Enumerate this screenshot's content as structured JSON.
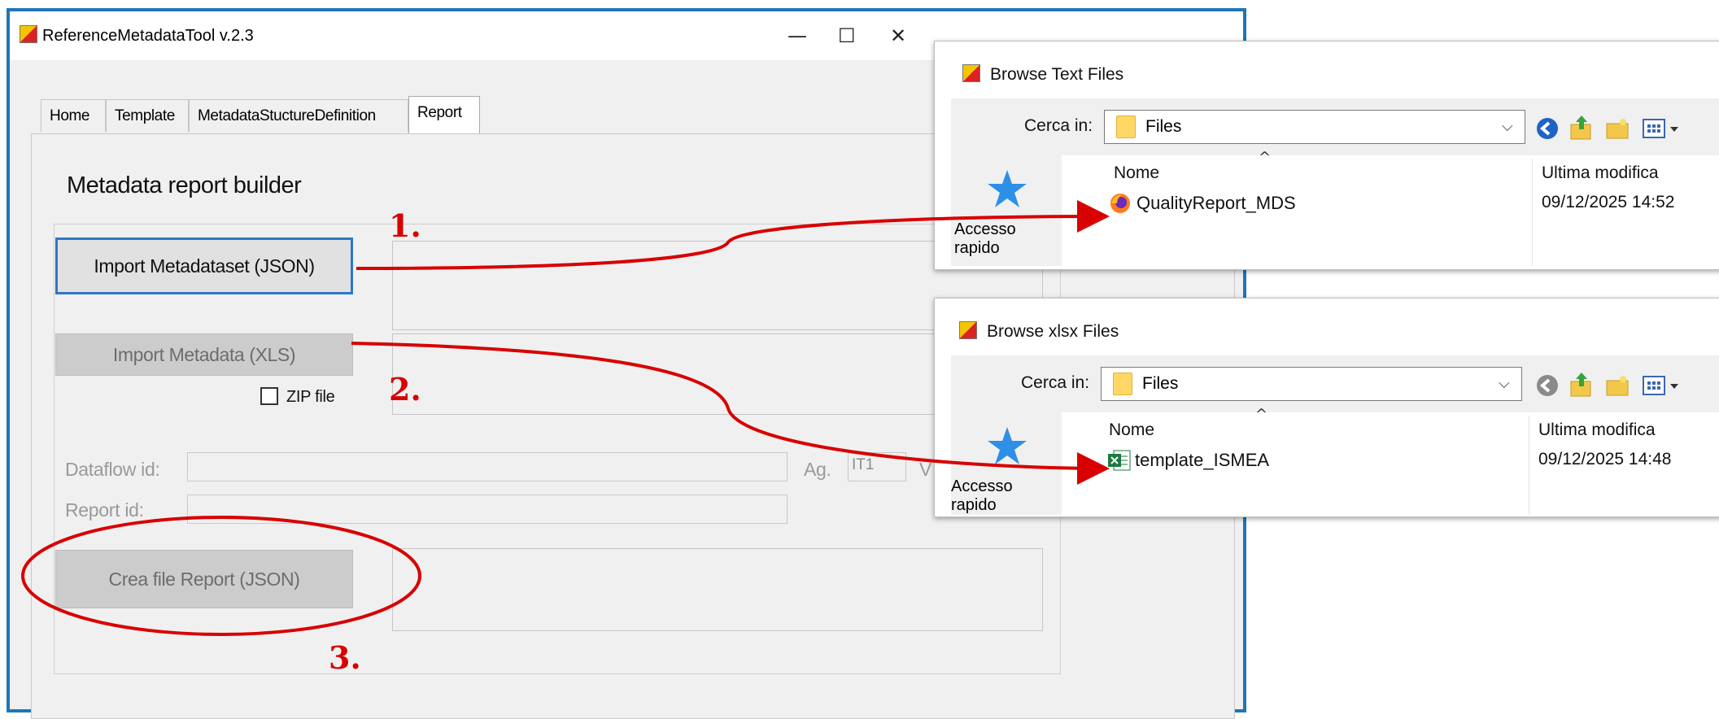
{
  "main_window": {
    "title": "ReferenceMetadataTool v.2.3",
    "controls": {
      "minimize": "—",
      "maximize": "☐",
      "close": "✕"
    },
    "tabs": [
      {
        "label": "Home"
      },
      {
        "label": "Template"
      },
      {
        "label": "MetadataStuctureDefinition"
      },
      {
        "label": "Report"
      }
    ],
    "report": {
      "heading": "Metadata report builder",
      "import_json_label": "Import Metadataset (JSON)",
      "import_xls_label": "Import Metadata (XLS)",
      "zip_label": "ZIP file",
      "dataflow_label": "Dataflow id:",
      "agency_label": "Ag.",
      "agency_value": "IT1",
      "version_label": "V",
      "report_id_label": "Report id:",
      "create_report_label": "Crea file Report (JSON)"
    }
  },
  "dialog_text": {
    "title": "Browse Text Files",
    "look_in_label": "Cerca in:",
    "folder": "Files",
    "quick_access": "Accesso rapido",
    "col_name": "Nome",
    "col_modified": "Ultima modifica",
    "file": {
      "name": "QualityReport_MDS",
      "modified": "09/12/2025 14:52"
    }
  },
  "dialog_xlsx": {
    "title": "Browse xlsx Files",
    "look_in_label": "Cerca in:",
    "folder": "Files",
    "quick_access": "Accesso rapido",
    "col_name": "Nome",
    "col_modified": "Ultima modifica",
    "file": {
      "name": "template_ISMEA",
      "modified": "09/12/2025 14:48"
    }
  },
  "annotations": {
    "step1": "1.",
    "step2": "2.",
    "step3": "3.",
    "color": "#d80000"
  },
  "icons": {
    "text_file": "firefox-icon",
    "xlsx_file": "excel-icon",
    "toolbar": [
      "back-icon",
      "up-folder-icon",
      "new-folder-icon",
      "view-menu-icon"
    ]
  }
}
